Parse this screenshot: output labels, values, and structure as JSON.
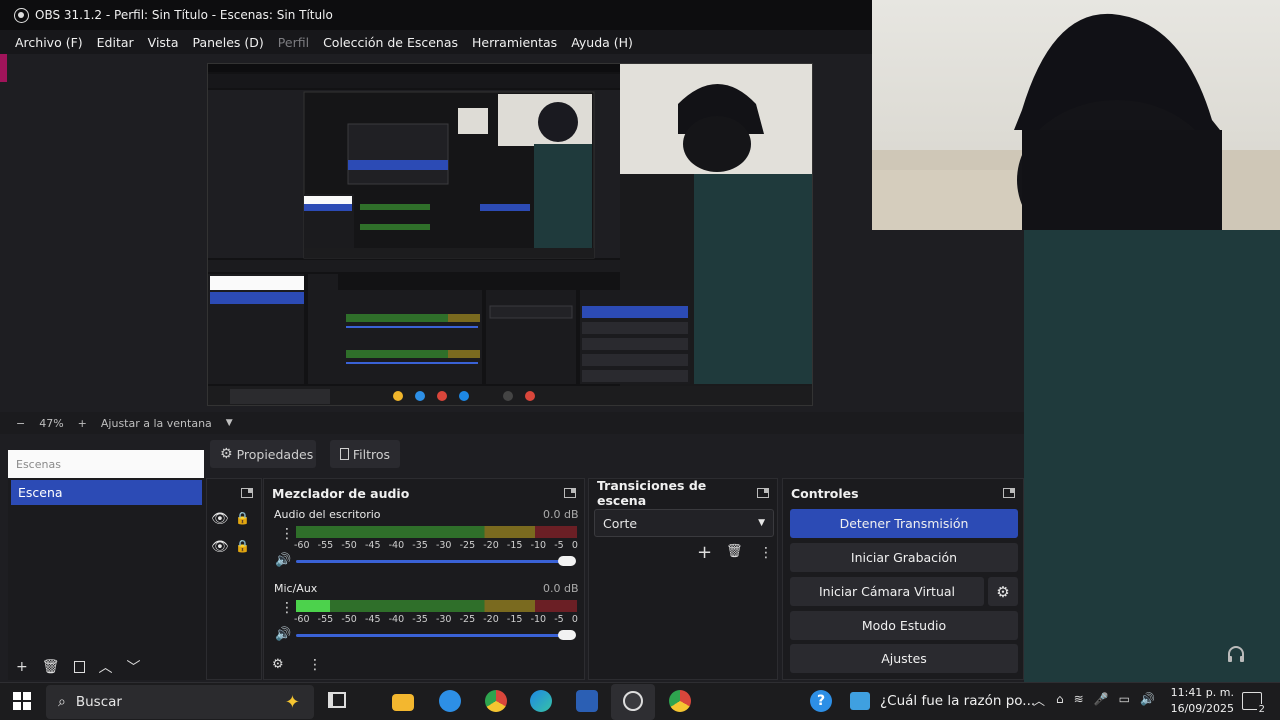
{
  "window": {
    "title": "OBS 31.1.2 - Perfil: Sin Título - Escenas: Sin Título"
  },
  "menu": [
    "Archivo (F)",
    "Editar",
    "Vista",
    "Paneles (D)",
    "Perfil",
    "Colección de Escenas",
    "Herramientas",
    "Ayuda (H)"
  ],
  "zoom": {
    "minus": "−",
    "level": "47%",
    "plus": "+",
    "fit_label": "Ajustar a la ventana"
  },
  "tabs": {
    "properties": "Propiedades",
    "filters": "Filtros"
  },
  "scenes": {
    "search_placeholder": "Escenas",
    "items": [
      "Escena"
    ]
  },
  "mixer": {
    "title": "Mezclador de audio",
    "channels": [
      {
        "name": "Audio del escritorio",
        "db": "0.0 dB",
        "level": 0
      },
      {
        "name": "Mic/Aux",
        "db": "0.0 dB",
        "level": 0.12
      }
    ],
    "ticks": [
      "-60",
      "-55",
      "-50",
      "-45",
      "-40",
      "-35",
      "-30",
      "-25",
      "-20",
      "-15",
      "-10",
      "-5",
      "0"
    ]
  },
  "transitions": {
    "title": "Transiciones de escena",
    "selected": "Corte"
  },
  "controls": {
    "title": "Controles",
    "stop_stream": "Detener Transmisión",
    "start_recording": "Iniciar Grabación",
    "start_virtual_cam": "Iniciar Cámara Virtual",
    "studio_mode": "Modo Estudio",
    "settings": "Ajustes"
  },
  "taskbar": {
    "search": "Buscar",
    "news": "¿Cuál fue la razón po...",
    "time": "11:41 p. m.",
    "date": "16/09/2025",
    "notifications": "2"
  },
  "colors": {
    "accent": "#2c4bb5",
    "teal": "#1f3a3c"
  }
}
